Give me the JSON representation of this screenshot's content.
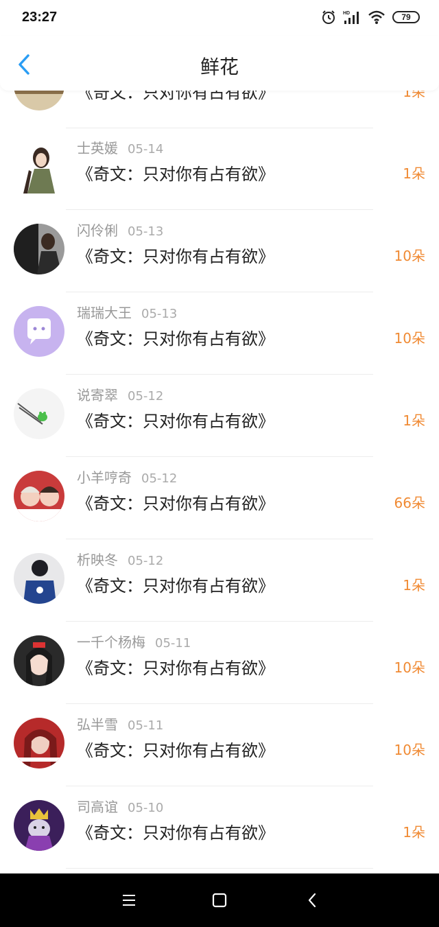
{
  "status": {
    "time": "23:27",
    "battery": "79"
  },
  "header": {
    "title": "鲜花"
  },
  "items": [
    {
      "name": "",
      "date": "",
      "book": "《奇文：只对你有占有欲》",
      "count": "1朵"
    },
    {
      "name": "士英媛",
      "date": "05-14",
      "book": "《奇文：只对你有占有欲》",
      "count": "1朵"
    },
    {
      "name": "闪伶俐",
      "date": "05-13",
      "book": "《奇文：只对你有占有欲》",
      "count": "10朵"
    },
    {
      "name": "瑞瑞大王",
      "date": "05-13",
      "book": "《奇文：只对你有占有欲》",
      "count": "10朵"
    },
    {
      "name": "说寄翠",
      "date": "05-12",
      "book": "《奇文：只对你有占有欲》",
      "count": "1朵"
    },
    {
      "name": "小羊哼奇",
      "date": "05-12",
      "book": "《奇文：只对你有占有欲》",
      "count": "66朵"
    },
    {
      "name": "析映冬",
      "date": "05-12",
      "book": "《奇文：只对你有占有欲》",
      "count": "1朵"
    },
    {
      "name": "一千个杨梅",
      "date": "05-11",
      "book": "《奇文：只对你有占有欲》",
      "count": "10朵"
    },
    {
      "name": "弘半雪",
      "date": "05-11",
      "book": "《奇文：只对你有占有欲》",
      "count": "10朵"
    },
    {
      "name": "司高谊",
      "date": "05-10",
      "book": "《奇文：只对你有占有欲》",
      "count": "1朵"
    }
  ],
  "colors": {
    "accent": "#2a9df4",
    "count": "#f08a33"
  },
  "icons": {
    "back": "chevron-left-icon",
    "menu": "menu-icon",
    "home": "square-icon",
    "sys_back": "triangle-back-icon"
  }
}
